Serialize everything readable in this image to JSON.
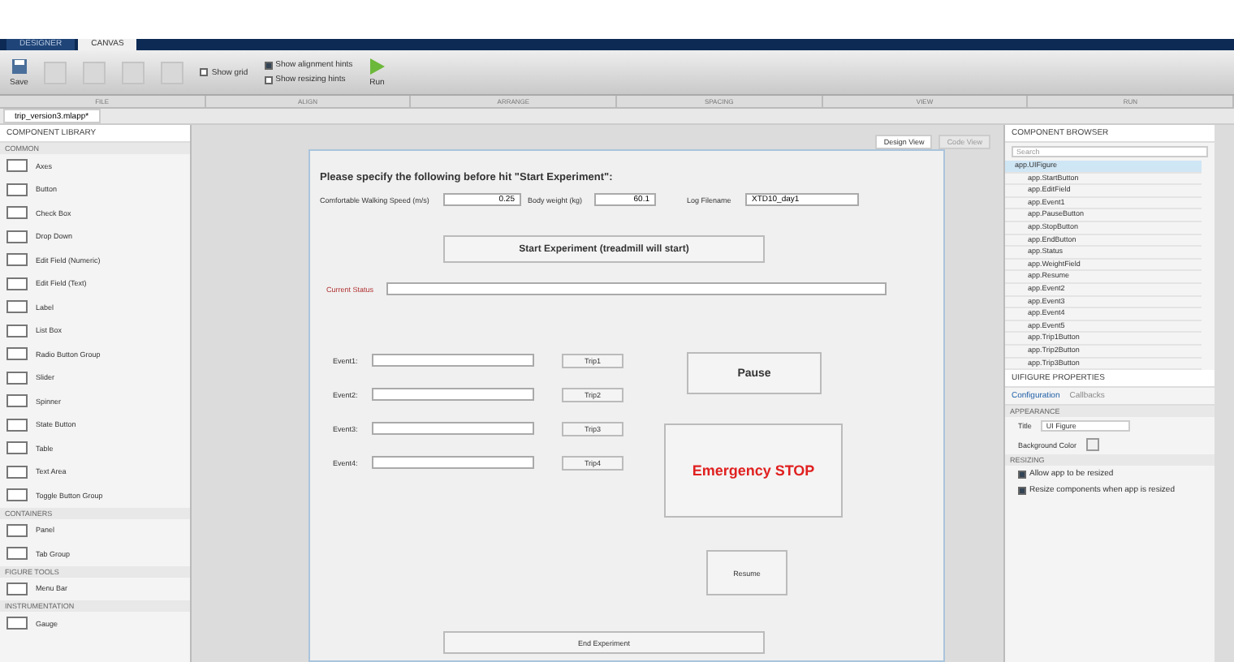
{
  "ribbon": {
    "tabs": [
      {
        "label": "DESIGNER",
        "selected": false
      },
      {
        "label": "CANVAS",
        "selected": true
      }
    ],
    "save": "Save",
    "run": "Run",
    "checks": [
      {
        "label": "Show grid",
        "checked": false
      },
      {
        "label": "Show alignment hints",
        "checked": true
      },
      {
        "label": "Show resizing hints",
        "checked": false
      }
    ],
    "sections": [
      "FILE",
      "ALIGN",
      "ARRANGE",
      "SPACING",
      "VIEW",
      "RUN"
    ]
  },
  "document_tab": "trip_version3.mlapp*",
  "library": {
    "title": "COMPONENT LIBRARY",
    "groups": [
      {
        "name": "COMMON",
        "items": [
          "Axes",
          "Button",
          "Check Box",
          "Drop Down",
          "Edit Field (Numeric)",
          "Edit Field (Text)",
          "Label",
          "List Box",
          "Radio Button Group",
          "Slider",
          "Spinner",
          "State Button",
          "Table",
          "Text Area",
          "Toggle Button Group"
        ]
      },
      {
        "name": "CONTAINERS",
        "items": [
          "Panel",
          "Tab Group"
        ]
      },
      {
        "name": "FIGURE TOOLS",
        "items": [
          "Menu Bar"
        ]
      },
      {
        "name": "INSTRUMENTATION",
        "items": [
          "Gauge"
        ]
      }
    ]
  },
  "views": [
    {
      "label": "Design View",
      "selected": true
    },
    {
      "label": "Code View",
      "selected": false
    }
  ],
  "canvas": {
    "heading": "Please specify the following before hit \"Start Experiment\":",
    "speed": {
      "label": "Comfortable Walking Speed (m/s)",
      "value": "0.25"
    },
    "weight": {
      "label": "Body weight (kg)",
      "value": "60.1"
    },
    "log": {
      "label": "Log Filename",
      "value": "XTD10_day1"
    },
    "start": "Start Experiment (treadmill will start)",
    "status_label": "Current Status",
    "events": [
      {
        "label": "Event1:",
        "button": "Trip1"
      },
      {
        "label": "Event2:",
        "button": "Trip2"
      },
      {
        "label": "Event3:",
        "button": "Trip3"
      },
      {
        "label": "Event4:",
        "button": "Trip4"
      }
    ],
    "pause": "Pause",
    "stop": "Emergency STOP",
    "resume": "Resume",
    "end": "End Experiment"
  },
  "browser": {
    "title": "COMPONENT BROWSER",
    "search": {
      "placeholder": "Search"
    },
    "items": [
      {
        "name": "app.UIFigure",
        "selected": true
      },
      {
        "name": "app.StartButton",
        "selected": false
      },
      {
        "name": "app.EditField",
        "selected": false
      },
      {
        "name": "app.Event1",
        "selected": false
      },
      {
        "name": "app.PauseButton",
        "selected": false
      },
      {
        "name": "app.StopButton",
        "selected": false
      },
      {
        "name": "app.EndButton",
        "selected": false
      },
      {
        "name": "app.Status",
        "selected": false
      },
      {
        "name": "app.WeightField",
        "selected": false
      },
      {
        "name": "app.Resume",
        "selected": false
      },
      {
        "name": "app.Event2",
        "selected": false
      },
      {
        "name": "app.Event3",
        "selected": false
      },
      {
        "name": "app.Event4",
        "selected": false
      },
      {
        "name": "app.Event5",
        "selected": false
      },
      {
        "name": "app.Trip1Button",
        "selected": false
      },
      {
        "name": "app.Trip2Button",
        "selected": false
      },
      {
        "name": "app.Trip3Button",
        "selected": false
      }
    ]
  },
  "properties": {
    "title": "UIFIGURE PROPERTIES",
    "tabs": [
      {
        "label": "Configuration",
        "selected": true
      },
      {
        "label": "Callbacks",
        "selected": false
      }
    ],
    "appearance": {
      "heading": "APPEARANCE",
      "title_label": "Title",
      "title_value": "UI Figure",
      "bg_label": "Background Color"
    },
    "resizing": {
      "heading": "RESIZING",
      "options": [
        {
          "label": "Allow app to be resized",
          "checked": true
        },
        {
          "label": "Resize components when app is resized",
          "checked": true
        }
      ]
    }
  }
}
